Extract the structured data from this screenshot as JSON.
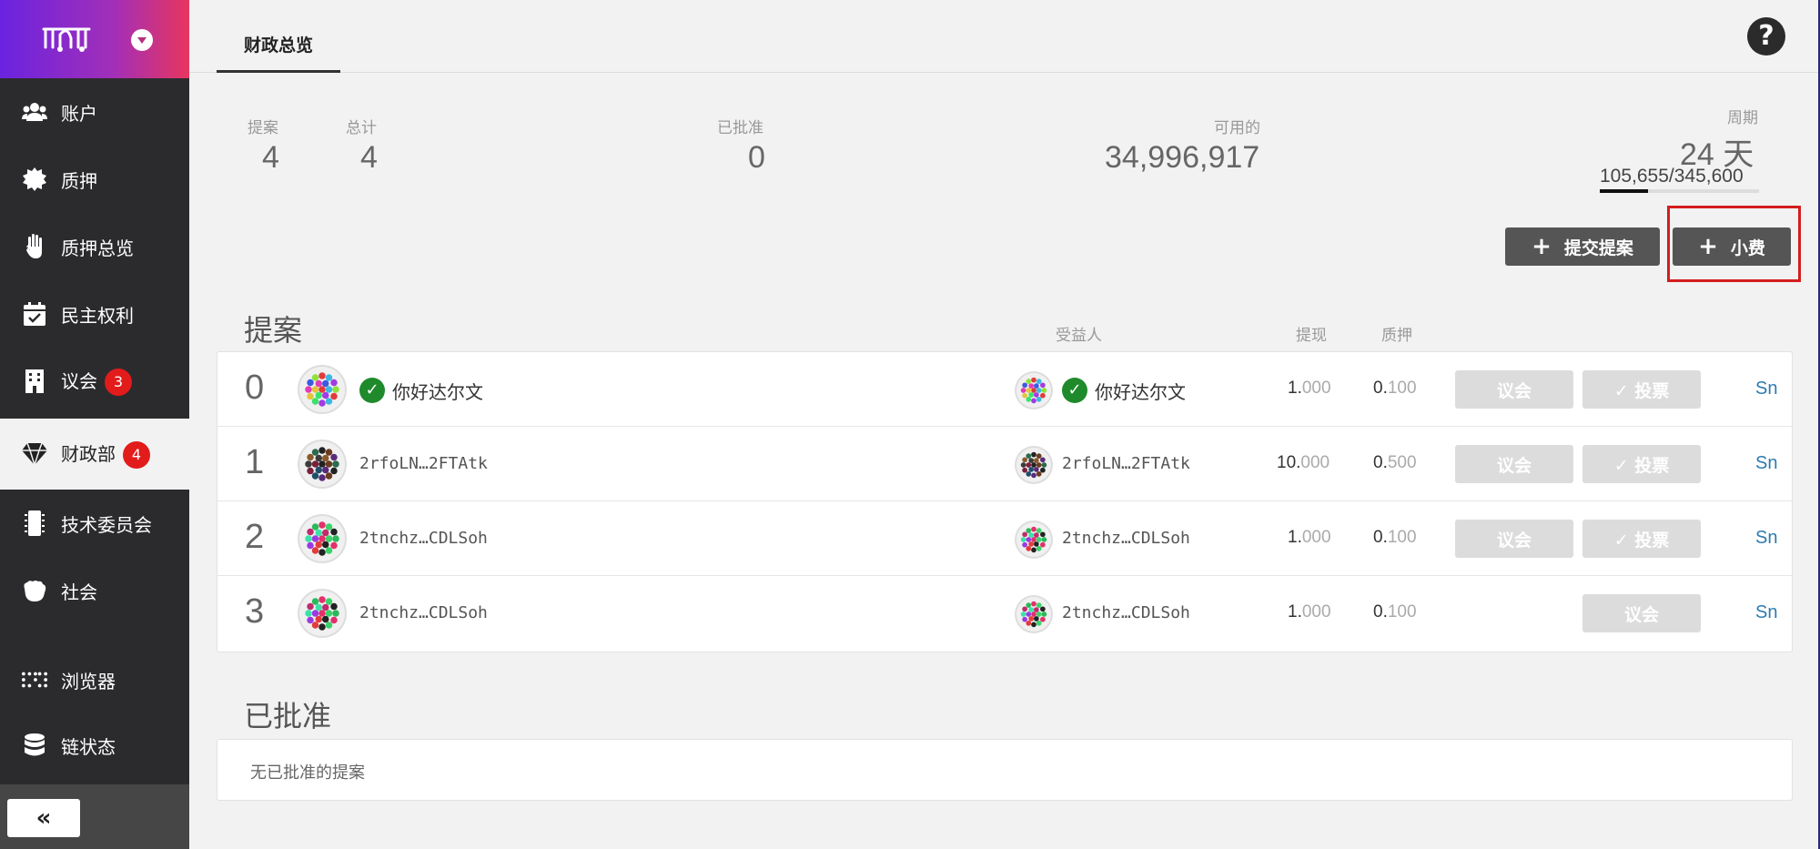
{
  "sidebar": {
    "logo_alt": "polkadot-js-logo",
    "items": [
      {
        "label": "账户",
        "icon": "users-icon"
      },
      {
        "label": "质押",
        "icon": "certificate-icon"
      },
      {
        "label": "质押总览",
        "icon": "hand-icon"
      },
      {
        "label": "民主权利",
        "icon": "calendar-check-icon"
      },
      {
        "label": "议会",
        "icon": "building-icon",
        "badge": "3"
      },
      {
        "label": "财政部",
        "icon": "gem-icon",
        "badge": "4",
        "active": true
      },
      {
        "label": "技术委员会",
        "icon": "microchip-icon"
      },
      {
        "label": "社会",
        "icon": "hand-paper-icon"
      },
      {
        "label": "浏览器",
        "icon": "braille-icon"
      },
      {
        "label": "链状态",
        "icon": "database-icon"
      }
    ],
    "collapse_label": "«"
  },
  "header": {
    "tab": "财政总览",
    "help": "?"
  },
  "summary": {
    "proposals_label": "提案",
    "proposals_value": "4",
    "total_label": "总计",
    "total_value": "4",
    "approved_label": "已批准",
    "approved_value": "0",
    "available_label": "可用的",
    "available_value": "34,996,917",
    "period_label": "周期",
    "period_value": "24 天",
    "period_progress": "105,655/345,600",
    "period_fraction": 0.3057
  },
  "actions": {
    "submit_label": "提交提案",
    "tip_label": "小费"
  },
  "proposals": {
    "title": "提案",
    "col_beneficiary": "受益人",
    "col_payout": "提现",
    "col_bond": "质押",
    "rows": [
      {
        "index": "0",
        "proposer": "你好达尔文",
        "beneficiary": "你好达尔文",
        "payout_int": "1.",
        "payout_dec": "000",
        "bond_int": "0.",
        "bond_dec": "100",
        "council": "议会",
        "vote": "✓ 投票",
        "link": "Sn"
      },
      {
        "index": "1",
        "proposer": "2rfoLN…2FTAtk",
        "beneficiary": "2rfoLN…2FTAtk",
        "payout_int": "10.",
        "payout_dec": "000",
        "bond_int": "0.",
        "bond_dec": "500",
        "council": "议会",
        "vote": "✓ 投票",
        "link": "Sn"
      },
      {
        "index": "2",
        "proposer": "2tnchz…CDLSoh",
        "beneficiary": "2tnchz…CDLSoh",
        "payout_int": "1.",
        "payout_dec": "000",
        "bond_int": "0.",
        "bond_dec": "100",
        "council": "议会",
        "vote": "✓ 投票",
        "link": "Sn"
      },
      {
        "index": "3",
        "proposer": "2tnchz…CDLSoh",
        "beneficiary": "2tnchz…CDLSoh",
        "payout_int": "1.",
        "payout_dec": "000",
        "bond_int": "0.",
        "bond_dec": "100",
        "council": "议会",
        "link": "Sn"
      }
    ]
  },
  "approved": {
    "title": "已批准",
    "empty": "无已批准的提案"
  }
}
